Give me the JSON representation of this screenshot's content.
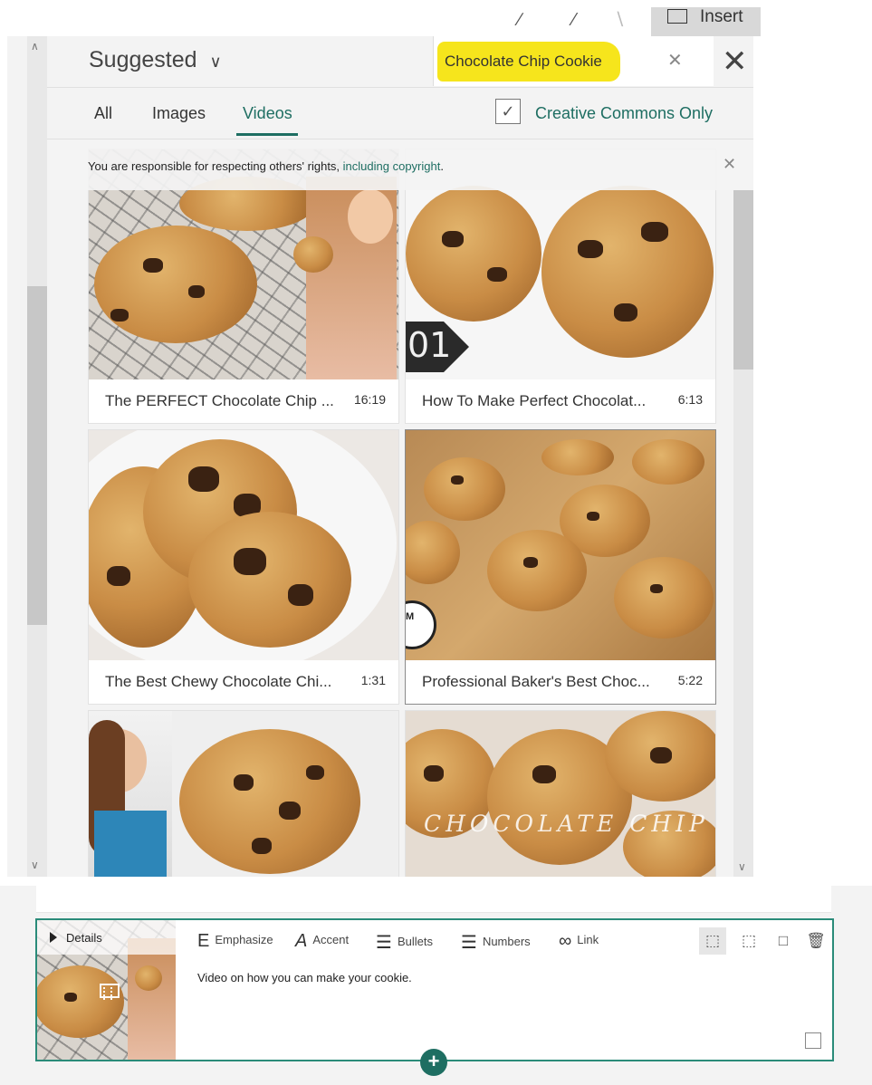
{
  "toolbar": {
    "insert_label": "Insert"
  },
  "panel": {
    "source_label": "Suggested",
    "search_query": "Chocolate Chip Cookie",
    "tabs": [
      {
        "label": "All",
        "active": false
      },
      {
        "label": "Images",
        "active": false
      },
      {
        "label": "Videos",
        "active": true
      }
    ],
    "creative_commons": {
      "label": "Creative Commons Only",
      "checked": true
    },
    "notice": {
      "text": "You are responsible for respecting others' rights, ",
      "link": "including copyright",
      "suffix": "."
    }
  },
  "results": [
    {
      "title": "The PERFECT Chocolate Chip ...",
      "duration": "16:19"
    },
    {
      "title": "How To Make Perfect Chocolat...",
      "duration": "6:13"
    },
    {
      "title": "The Best Chewy Chocolate Chi...",
      "duration": "1:31"
    },
    {
      "title": "Professional Baker's Best Choc...",
      "duration": "5:22"
    },
    {
      "title": "",
      "duration": ""
    },
    {
      "title": "",
      "duration": ""
    }
  ],
  "overlay_texts": {
    "badge": "01",
    "banner": "CHOCOLATE CHIP",
    "roundel": "M"
  },
  "details": {
    "label": "Details",
    "toolbar": {
      "emphasize": "Emphasize",
      "accent": "Accent",
      "bullets": "Bullets",
      "numbers": "Numbers",
      "link": "Link"
    },
    "body": "Video on how you can make your cookie."
  },
  "colors": {
    "accent": "#1e6e62",
    "highlight": "#f6e51c",
    "border": "#2a8b79"
  }
}
